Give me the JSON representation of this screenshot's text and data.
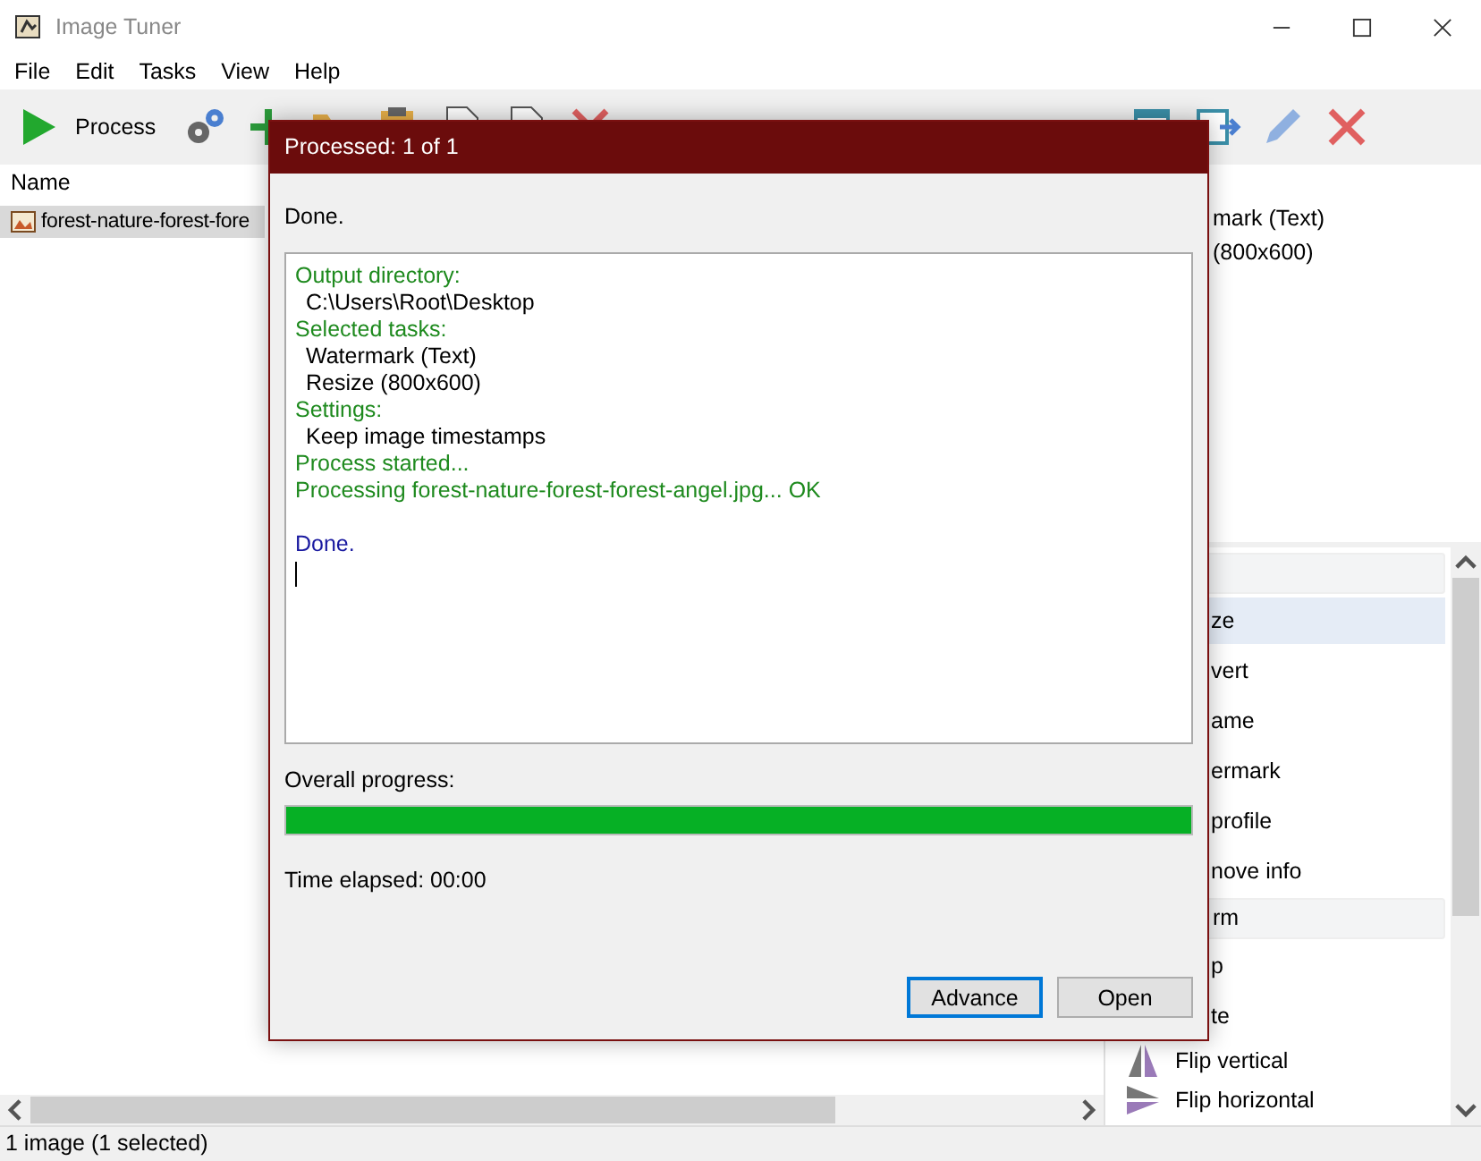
{
  "window": {
    "title": "Image Tuner"
  },
  "menu": [
    "File",
    "Edit",
    "Tasks",
    "View",
    "Help"
  ],
  "toolbar": {
    "process_label": "Process"
  },
  "file_list": {
    "column": "Name",
    "rows": [
      {
        "name": "forest-nature-forest-fore",
        "selected": true
      }
    ]
  },
  "task_list": [
    "mark (Text)",
    "(800x600)"
  ],
  "actions": [
    {
      "kind": "header"
    },
    {
      "kind": "item",
      "label": "ze",
      "selected": true
    },
    {
      "kind": "item",
      "label": "vert",
      "selected": false
    },
    {
      "kind": "item",
      "label": "ame",
      "selected": false
    },
    {
      "kind": "item",
      "label": "ermark",
      "selected": false
    },
    {
      "kind": "item",
      "label": "profile",
      "selected": false
    },
    {
      "kind": "item",
      "label": "nove info",
      "selected": false
    },
    {
      "kind": "header",
      "label": "rm"
    },
    {
      "kind": "item",
      "label": "p",
      "selected": false
    },
    {
      "kind": "item",
      "label": "te",
      "selected": false
    },
    {
      "kind": "flip-v",
      "label": "Flip vertical",
      "selected": false
    },
    {
      "kind": "flip-h",
      "label": "Flip horizontal",
      "selected": false
    }
  ],
  "status_bar": "1 image (1 selected)",
  "dialog": {
    "title": "Processed: 1 of 1",
    "message": "Done.",
    "log": [
      {
        "kind": "heading",
        "text": "Output directory:"
      },
      {
        "kind": "value",
        "text": "C:\\Users\\Root\\Desktop"
      },
      {
        "kind": "heading",
        "text": "Selected tasks:"
      },
      {
        "kind": "value",
        "text": "Watermark (Text)"
      },
      {
        "kind": "value",
        "text": "Resize (800x600)"
      },
      {
        "kind": "heading",
        "text": "Settings:"
      },
      {
        "kind": "value",
        "text": "Keep image timestamps"
      },
      {
        "kind": "heading",
        "text": "Process started..."
      },
      {
        "kind": "heading",
        "text": "Processing forest-nature-forest-forest-angel.jpg... OK"
      },
      {
        "kind": "blank"
      },
      {
        "kind": "done",
        "text": "Done."
      }
    ],
    "progress_label": "Overall progress:",
    "level": 1,
    "elapsed": "Time elapsed: 00:00",
    "buttons": [
      {
        "label": "Advance",
        "default": true
      },
      {
        "label": "Open",
        "default": false
      }
    ]
  }
}
